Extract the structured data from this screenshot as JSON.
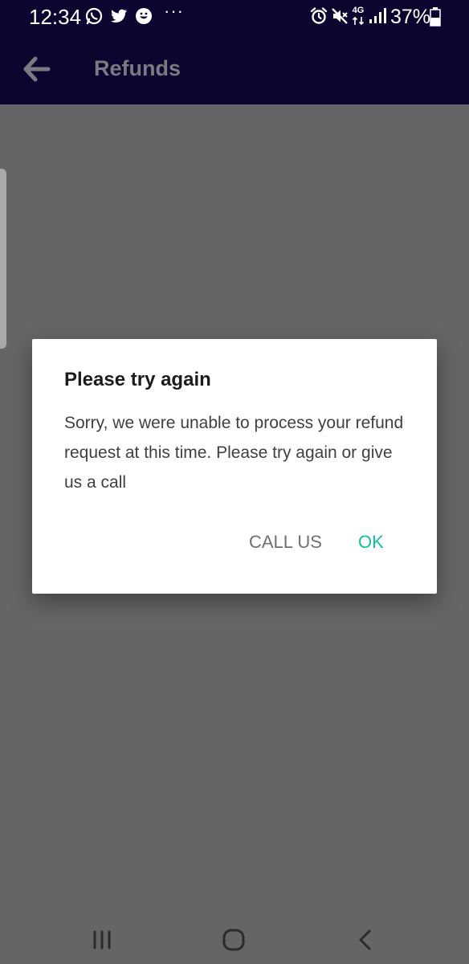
{
  "status_bar": {
    "time": "12:34",
    "dots": "···",
    "network": "4G",
    "battery": "37%"
  },
  "app_bar": {
    "title": "Refunds"
  },
  "dialog": {
    "title": "Please try again",
    "message": "Sorry, we were unable to process your refund request at this time. Please try again or give us a call",
    "call_label": "CALL US",
    "ok_label": "OK"
  },
  "colors": {
    "app_bar": "#0b0530",
    "accent": "#13bfa6",
    "scrim": "#646567"
  },
  "icons": {
    "back": "arrow-left-icon",
    "recents": "recents-icon",
    "home": "home-icon",
    "nav_back": "nav-back-icon"
  }
}
